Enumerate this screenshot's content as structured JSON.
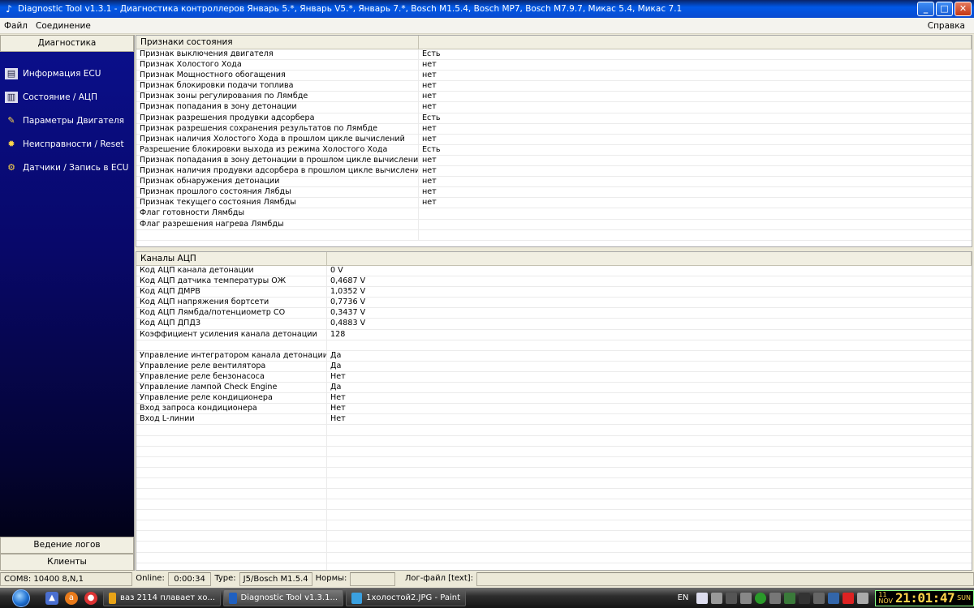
{
  "window": {
    "title": "Diagnostic Tool v1.3.1 - Диагностика контроллеров Январь 5.*, Январь V5.*, Январь 7.*, Bosch M1.5.4, Bosch MP7, Bosch M7.9.7, Микас 5.4, Микас 7.1",
    "minimize": "_",
    "maximize": "□",
    "close": "✕"
  },
  "menu": {
    "file": "Файл",
    "connection": "Соединение",
    "help": "Справка"
  },
  "sidebar": {
    "header": "Диагностика",
    "items": [
      {
        "label": "Информация ECU",
        "icon": "ecu-info-icon"
      },
      {
        "label": "Состояние / АЦП",
        "icon": "status-adc-icon"
      },
      {
        "label": "Параметры Двигателя",
        "icon": "engine-params-icon"
      },
      {
        "label": "Неисправности / Reset",
        "icon": "faults-icon"
      },
      {
        "label": "Датчики / Запись в ECU",
        "icon": "sensors-icon"
      }
    ],
    "logs": "Ведение логов",
    "clients": "Клиенты"
  },
  "flags": {
    "header_name": "Признаки состояния",
    "header_value": "",
    "rows": [
      [
        "Признак выключения двигателя",
        "Есть"
      ],
      [
        "Признак Холостого Хода",
        "нет"
      ],
      [
        "Признак Мощностного обогащения",
        "нет"
      ],
      [
        "Признак блокировки подачи топлива",
        "нет"
      ],
      [
        "Признак зоны регулирования по Лямбде",
        "нет"
      ],
      [
        "Признак попадания в зону детонации",
        "нет"
      ],
      [
        "Признак разрешения продувки адсорбера",
        "Есть"
      ],
      [
        "Признак разрешения сохранения результатов по Лямбде",
        "нет"
      ],
      [
        "Признак наличия Холостого Хода в прошлом цикле вычислений",
        "нет"
      ],
      [
        "Разрешение блокировки выхода из режима Холостого Хода",
        "Есть"
      ],
      [
        "Признак попадания в зону детонации в прошлом цикле вычислений",
        "нет"
      ],
      [
        "Признак наличия продувки адсорбера в прошлом цикле вычислений",
        "нет"
      ],
      [
        "Признак обнаружения детонации",
        "нет"
      ],
      [
        "Признак прошлого состояния Лябды",
        "нет"
      ],
      [
        "Признак текущего состояния Лямбды",
        "нет"
      ],
      [
        "Флаг готовности Лямбды",
        ""
      ],
      [
        "Флаг разрешения нагрева Лямбды",
        ""
      ],
      [
        "",
        ""
      ]
    ]
  },
  "adc": {
    "header_name": "Каналы АЦП",
    "header_value": "",
    "rows": [
      [
        "Код АЦП канала детонации",
        "0 V"
      ],
      [
        "Код АЦП датчика температуры ОЖ",
        "0,4687 V"
      ],
      [
        "Код АЦП ДМРВ",
        "1,0352 V"
      ],
      [
        "Код АЦП напряжения бортсети",
        "0,7736 V"
      ],
      [
        "Код АЦП Лямбда/потенциометр CO",
        "0,3437 V"
      ],
      [
        "Код АЦП ДПДЗ",
        "0,4883 V"
      ],
      [
        "Коэффициент усиления канала детонации",
        "128"
      ],
      [
        "",
        ""
      ],
      [
        "Управление интегратором канала детонации",
        "Да"
      ],
      [
        "Управление реле вентилятора",
        "Да"
      ],
      [
        "Управление реле бензонасоса",
        "Нет"
      ],
      [
        "Управление лампой Check Engine",
        "Да"
      ],
      [
        "Управление реле кондиционера",
        "Нет"
      ],
      [
        "Вход запроса кондиционера",
        "Нет"
      ],
      [
        "Вход L-линии",
        "Нет"
      ],
      [
        "",
        ""
      ],
      [
        "",
        ""
      ],
      [
        "",
        ""
      ],
      [
        "",
        ""
      ],
      [
        "",
        ""
      ],
      [
        "",
        ""
      ],
      [
        "",
        ""
      ],
      [
        "",
        ""
      ],
      [
        "",
        ""
      ],
      [
        "",
        ""
      ],
      [
        "",
        ""
      ],
      [
        "",
        ""
      ],
      [
        "",
        ""
      ],
      [
        "",
        ""
      ],
      [
        "",
        ""
      ]
    ]
  },
  "status": {
    "port": "COM8: 10400 8,N,1",
    "online_label": "Online:",
    "online_value": "0:00:34",
    "type_label": "Type:",
    "type_value": "J5/Bosch M1.5.4",
    "norms_label": "Нормы:",
    "norms_value": "",
    "log_label": "Лог-файл [text]:",
    "log_value": ""
  },
  "taskbar": {
    "tasks": [
      {
        "label": "ваз 2114 плавает хо...",
        "icon_color": "#e8a317",
        "icon": "chrome-icon"
      },
      {
        "label": "Diagnostic Tool v1.3.1...",
        "icon_color": "#2060c0",
        "icon": "diagnostic-tool-icon"
      },
      {
        "label": "1холостой2.JPG - Paint",
        "icon_color": "#3aa0e0",
        "icon": "paint-icon"
      }
    ],
    "lang": "EN",
    "clock": {
      "day_num": "11",
      "month": "NOV",
      "time": "21:01:47",
      "weekday": "SUN"
    }
  }
}
